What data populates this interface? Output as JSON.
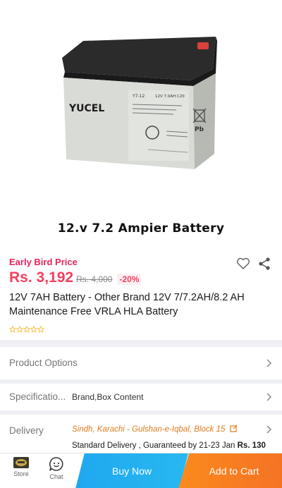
{
  "hero": {
    "caption": "12.v 7.2 Ampier Battery",
    "battery_brand": "YUCEL",
    "battery_model": "Y7-12",
    "battery_rating": "12V 7.0AH C20",
    "battery_text": "Valve regulated lead-acid type rechargeable battery"
  },
  "price": {
    "promo_label": "Early Bird Price",
    "current": "Rs. 3,192",
    "original": "Rs. 4,000",
    "discount": "-20%"
  },
  "product": {
    "title": "12V 7AH Battery - Other Brand 12V 7/7.2AH/8.2 AH Maintenance Free VRLA HLA Battery",
    "rating_stars": 0
  },
  "rows": {
    "options_label": "Product Options",
    "spec_label": "Specificatio...",
    "spec_value": "Brand,Box Content",
    "delivery_label": "Delivery",
    "delivery_address": "Sindh, Karachi - Gulshan-e-Iqbal, Block 15",
    "delivery_standard": "Standard Delivery , Guaranteed by 21-23 Jan",
    "delivery_fee": "Rs. 130"
  },
  "bottom": {
    "store_label": "Store",
    "chat_label": "Chat",
    "buy_now": "Buy Now",
    "add_to_cart": "Add to Cart"
  },
  "colors": {
    "price": "#f33f5f",
    "buy_now": "#1fa8f0",
    "add_to_cart": "#f57224",
    "delivery_address": "#e07b1f"
  }
}
